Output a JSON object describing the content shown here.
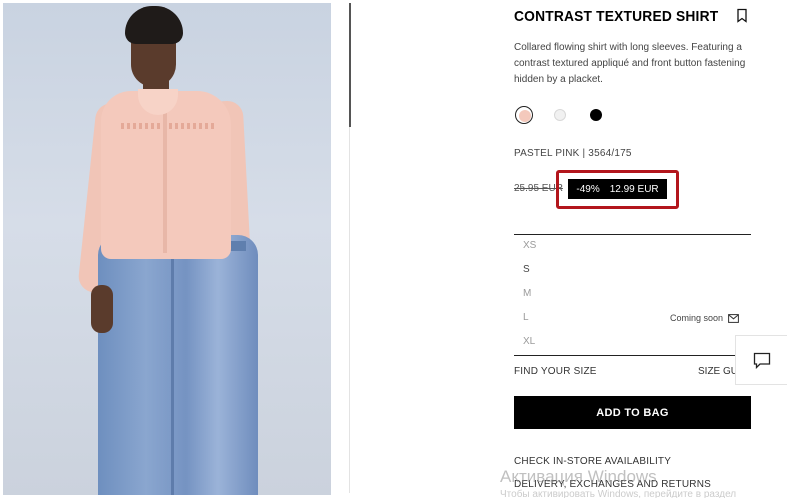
{
  "product": {
    "title": "CONTRAST TEXTURED SHIRT",
    "description": "Collared flowing shirt with long sleeves. Featuring a contrast textured appliqué and front button fastening hidden by a placket.",
    "color_ref": "PASTEL PINK | 3564/175",
    "swatches": [
      {
        "name": "pastel-pink",
        "color": "#f4c9bc",
        "selected": true
      },
      {
        "name": "white",
        "color": "#f1f1f1",
        "selected": false
      },
      {
        "name": "black",
        "color": "#000000",
        "selected": false
      }
    ]
  },
  "price": {
    "original": "25.95 EUR",
    "discount": "-49%",
    "current": "12.99 EUR"
  },
  "sizes": [
    "XS",
    "S",
    "M",
    "L",
    "XL"
  ],
  "coming_soon": "Coming soon",
  "links": {
    "find_size": "FIND YOUR SIZE",
    "size_guide": "SIZE GUIDE",
    "add_to_bag": "ADD TO BAG",
    "check_store": "CHECK IN-STORE AVAILABILITY",
    "delivery": "DELIVERY, EXCHANGES AND RETURNS"
  },
  "watermark": {
    "title": "Активация Windows",
    "subtitle": "Чтобы активировать Windows, перейдите в раздел"
  },
  "colors": {
    "highlight": "#b3161c",
    "badge_bg": "#000000"
  }
}
